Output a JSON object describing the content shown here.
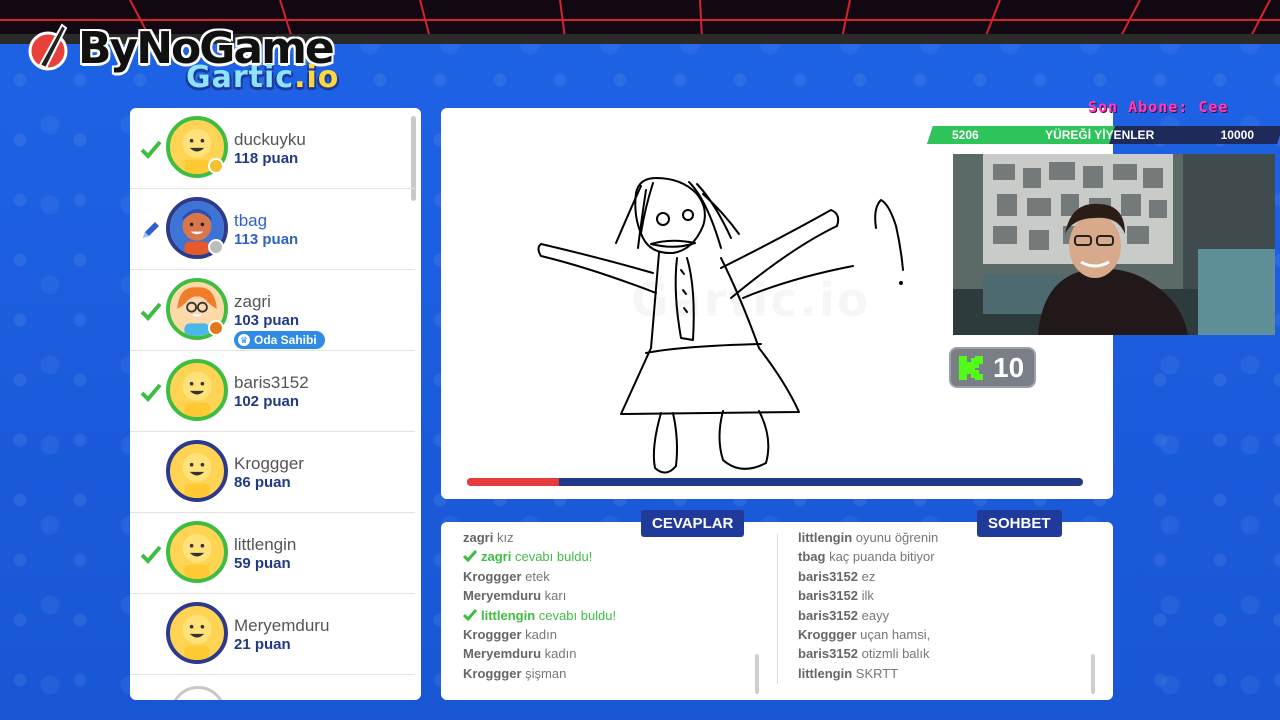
{
  "overlay": {
    "brand": "ByNoGame",
    "game_logo": "Gartic",
    "game_logo_tld": ".io",
    "sub_ticker": "Son Abone: Cee",
    "goal": {
      "current": "5206",
      "label": "YÜREĞİ YİYENLER",
      "target": "10000",
      "progress": 0.52
    },
    "kick_icon": "kick-logo-icon",
    "kick_count": "10"
  },
  "players": [
    {
      "name": "duckuyku",
      "points": "118 puan",
      "status": "correct",
      "dot": "#f2c12e"
    },
    {
      "name": "tbag",
      "points": "113 puan",
      "status": "drawing",
      "dot": "#bdbdbd"
    },
    {
      "name": "zagri",
      "points": "103 puan",
      "status": "correct",
      "dot": "#e0781e",
      "badge": "Oda Sahibi"
    },
    {
      "name": "baris3152",
      "points": "102 puan",
      "status": "correct"
    },
    {
      "name": "Kroggger",
      "points": "86 puan",
      "status": "none"
    },
    {
      "name": "littlengin",
      "points": "59 puan",
      "status": "correct"
    },
    {
      "name": "Meryemduru",
      "points": "21 puan",
      "status": "none"
    }
  ],
  "canvas": {
    "watermark": "Gartic.io",
    "timer_fraction": 0.15
  },
  "answers": {
    "tab": "CEVAPLAR",
    "partial_top": "",
    "messages": [
      {
        "user": "zagri",
        "text": "kız"
      },
      {
        "user": "zagri",
        "text": "cevabı buldu!",
        "correct": true
      },
      {
        "user": "Kroggger",
        "text": "etek"
      },
      {
        "user": "Meryemduru",
        "text": "karı"
      },
      {
        "user": "littlengin",
        "text": "cevabı buldu!",
        "correct": true
      },
      {
        "user": "Kroggger",
        "text": "kadın"
      },
      {
        "user": "Meryemduru",
        "text": "kadın"
      },
      {
        "user": "Kroggger",
        "text": "şişman"
      }
    ]
  },
  "chat": {
    "tab": "SOHBET",
    "messages": [
      {
        "user": "littlengin",
        "text": "oyunu öğrenin"
      },
      {
        "user": "tbag",
        "text": "kaç puanda bitiyor"
      },
      {
        "user": "baris3152",
        "text": "ez"
      },
      {
        "user": "baris3152",
        "text": "ilk"
      },
      {
        "user": "baris3152",
        "text": "eayy"
      },
      {
        "user": "Kroggger",
        "text": "uçan hamsi,"
      },
      {
        "user": "baris3152",
        "text": "otizmli balık"
      },
      {
        "user": "littlengin",
        "text": "SKRTT"
      }
    ]
  }
}
